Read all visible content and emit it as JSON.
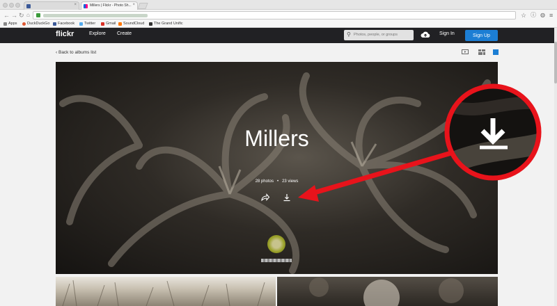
{
  "browser": {
    "tabs": [
      {
        "title": "",
        "active": false
      },
      {
        "title": "Millers | Flickr - Photo Sh...",
        "active": true
      }
    ],
    "bookmarks": [
      "Apps",
      "DuckDuckGo",
      "Facebook",
      "Twitter",
      "Gmail",
      "SoundCloud",
      "The Grand Unific"
    ]
  },
  "header": {
    "logo": "flickr",
    "nav": [
      "Explore",
      "Create"
    ],
    "search_placeholder": "Photos, people, or groups",
    "sign_in": "Sign In",
    "sign_up": "Sign Up"
  },
  "subbar": {
    "back_link": "Back to albums list"
  },
  "album": {
    "title": "Millers",
    "photos": "28 photos",
    "views": "23 views",
    "separator": "•"
  },
  "colors": {
    "header_bg": "#212124",
    "sign_up_bg": "#1c7ed4",
    "annotation_red": "#e8131b"
  },
  "icons": {
    "share": "share-arrow-icon",
    "download": "download-icon",
    "upload": "cloud-upload-icon"
  }
}
